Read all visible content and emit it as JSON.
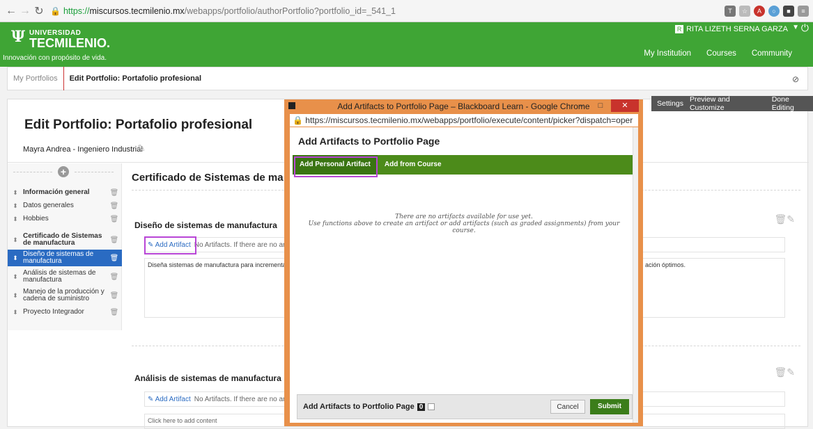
{
  "browser": {
    "url_https": "https://",
    "url_host": "miscursos.tecmilenio.mx",
    "url_rest": "/webapps/portfolio/authorPortfolio?portfolio_id=_541_1"
  },
  "header": {
    "logo_line1": "UNIVERSIDAD",
    "logo_line2": "TECMILENIO.",
    "slogan": "Innovación con propósito de vida.",
    "user_name": "RITA LIZETH SERNA GARZA",
    "nav": [
      "My Institution",
      "Courses",
      "Community"
    ]
  },
  "breadcrumb": {
    "item1": "My Portfolios",
    "item2": "Edit Portfolio: Portafolio profesional"
  },
  "toolbar": [
    "Settings",
    "Preview and Customize",
    "Done Editing"
  ],
  "main": {
    "title": "Edit Portfolio: Portafolio profesional",
    "author": "Mayra Andrea - Ingeniero Industrial",
    "section_title": "Certificado de Sistemas de ma",
    "nav_items": [
      {
        "label": "Información general",
        "bold": true
      },
      {
        "label": "Datos generales",
        "bold": false
      },
      {
        "label": "Hobbies",
        "bold": false
      },
      {
        "label": "Certificado de Sistemas de manufactura",
        "bold": true
      },
      {
        "label": "Diseño de sistemas de manufactura",
        "bold": false,
        "active": true
      },
      {
        "label": "Análisis de sistemas de manufactura",
        "bold": false
      },
      {
        "label": "Manejo de la producción y cadena de suministro",
        "bold": false
      },
      {
        "label": "Proyecto Integrador",
        "bold": false
      }
    ],
    "block1": {
      "title": "Diseño de sistemas de manufactura",
      "add_artifact": "✎ Add Artifact",
      "no_artifacts": "No Artifacts. If there are no art",
      "content_left": "Diseña sistemas de manufactura para incrementar",
      "content_right": "ación óptimos."
    },
    "block2": {
      "title": "Análisis de sistemas de manufactura",
      "add_artifact": "✎ Add Artifact",
      "no_artifacts": "No Artifacts. If there are no art",
      "content": "Click here to add content"
    }
  },
  "popup": {
    "window_title": "Add Artifacts to Portfolio Page – Blackboard Learn - Google Chrome",
    "url": "https://miscursos.tecmilenio.mx/webapps/portfolio/execute/content/picker?dispatch=oper",
    "heading": "Add Artifacts to Portfolio Page",
    "tabs": [
      "Add Personal Artifact",
      "Add from Course"
    ],
    "empty_line1": "There are no artifacts available for use yet.",
    "empty_line2": "Use functions above to create an artifact or add artifacts (such as graded assignments) from your course.",
    "footer_label": "Add Artifacts to Portfolio Page",
    "count": "0",
    "cancel": "Cancel",
    "submit": "Submit"
  }
}
